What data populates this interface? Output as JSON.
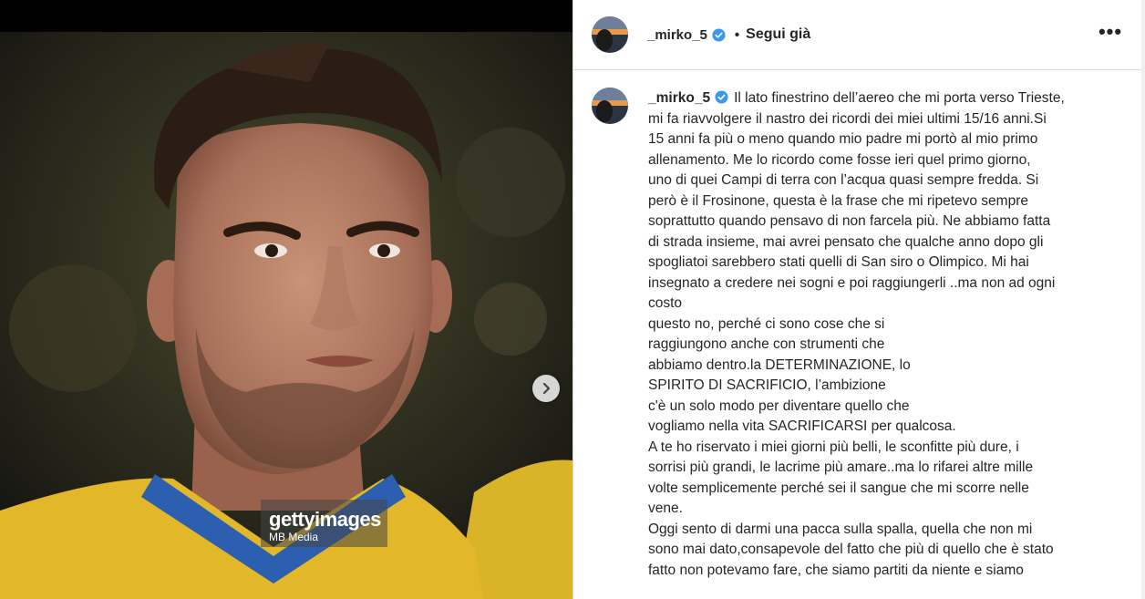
{
  "post": {
    "author": "_mirko_5",
    "follow_label": "Segui già",
    "dot": "•",
    "more_label": "•••",
    "verified_icon": "verified-badge-icon",
    "verified_color": "#3897f0"
  },
  "media": {
    "watermark_brand": "gettyimages",
    "watermark_credit": "MB Media",
    "next_icon": "chevron-right-icon"
  },
  "caption": {
    "lines": [
      "Il lato finestrino dell’aereo che mi porta verso Trieste,",
      "mi fa riavvolgere il nastro dei ricordi dei miei ultimi 15/16 anni.Si",
      "15 anni fa più o meno quando mio padre mi portò al mio primo",
      "allenamento. Me lo ricordo come fosse ieri quel primo giorno,",
      "uno di quei Campi di terra con l’acqua quasi sempre fredda. Si",
      "però è il Frosinone, questa è la frase che mi ripetevo sempre",
      "soprattutto quando pensavo di non farcela più. Ne abbiamo fatta",
      "di strada insieme, mai avrei pensato che qualche anno dopo gli",
      "spogliatoi sarebbero stati quelli di San siro o Olimpico. Mi hai",
      "insegnato a credere nei sogni e poi raggiungerli ..ma non ad ogni",
      "costo",
      "questo no, perché ci sono cose che si",
      "raggiungono anche con strumenti che",
      "abbiamo dentro.la DETERMINAZIONE, lo",
      "SPIRITO DI SACRIFICIO, l’ambizione",
      "c'è un solo modo per diventare quello che",
      "vogliamo nella vita SACRIFICARSI per qualcosa.",
      "A te ho riservato i miei giorni più belli, le sconfitte più dure, i",
      "sorrisi più grandi, le lacrime più amare..ma lo rifarei altre mille",
      "volte semplicemente perché sei il sangue che mi scorre nelle",
      "vene.",
      "Oggi sento di darmi una pacca sulla spalla, quella che non mi",
      "sono mai dato,consapevole del fatto che più di quello che è stato",
      "fatto non potevamo fare, che siamo partiti da niente e siamo"
    ]
  }
}
